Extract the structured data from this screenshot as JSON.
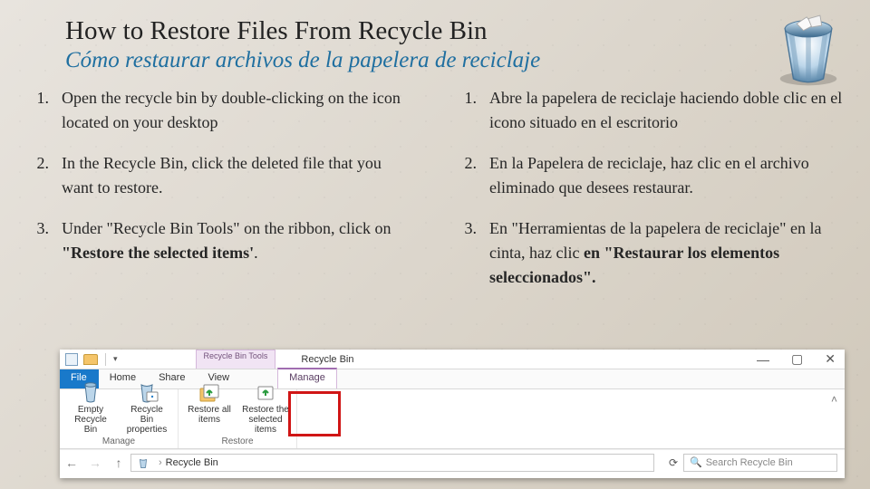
{
  "header": {
    "title_en": "How to Restore Files From Recycle Bin",
    "title_es": "Cómo restaurar archivos de la papelera de reciclaje"
  },
  "english_steps": [
    {
      "num": "1.",
      "text": "Open the recycle bin by double-clicking on the icon located on your desktop"
    },
    {
      "num": "2.",
      "text": "In the Recycle Bin, click the deleted file that you want to restore."
    },
    {
      "num": "3.",
      "pre": "Under \"Recycle Bin Tools\" on the ribbon, click on ",
      "bold": "\"Restore the selected items'",
      "post": "."
    }
  ],
  "spanish_steps": [
    {
      "num": "1.",
      "text": "Abre la papelera de reciclaje haciendo doble clic en el icono situado en el escritorio"
    },
    {
      "num": "2.",
      "text": "En la Papelera de reciclaje, haz clic en el archivo eliminado que desees restaurar."
    },
    {
      "num": "3.",
      "pre": "En \"Herramientas de la papelera de reciclaje\" en la cinta, haz clic ",
      "bold": "en \"Restaurar los elementos seleccionados\".",
      "post": ""
    }
  ],
  "window": {
    "tab_group_label": "Recycle Bin Tools",
    "title": "Recycle Bin",
    "tabs": {
      "file": "File",
      "home": "Home",
      "share": "Share",
      "view": "View",
      "manage": "Manage"
    },
    "ribbon": {
      "empty_bin": "Empty Recycle Bin",
      "properties": "Recycle Bin properties",
      "restore_all": "Restore all items",
      "restore_sel": "Restore the selected items",
      "group_manage": "Manage",
      "group_restore": "Restore"
    },
    "address": {
      "path_item": "Recycle Bin",
      "search_placeholder": "Search Recycle Bin"
    },
    "controls": {
      "min": "—",
      "max": "▢",
      "close": "✕"
    }
  }
}
